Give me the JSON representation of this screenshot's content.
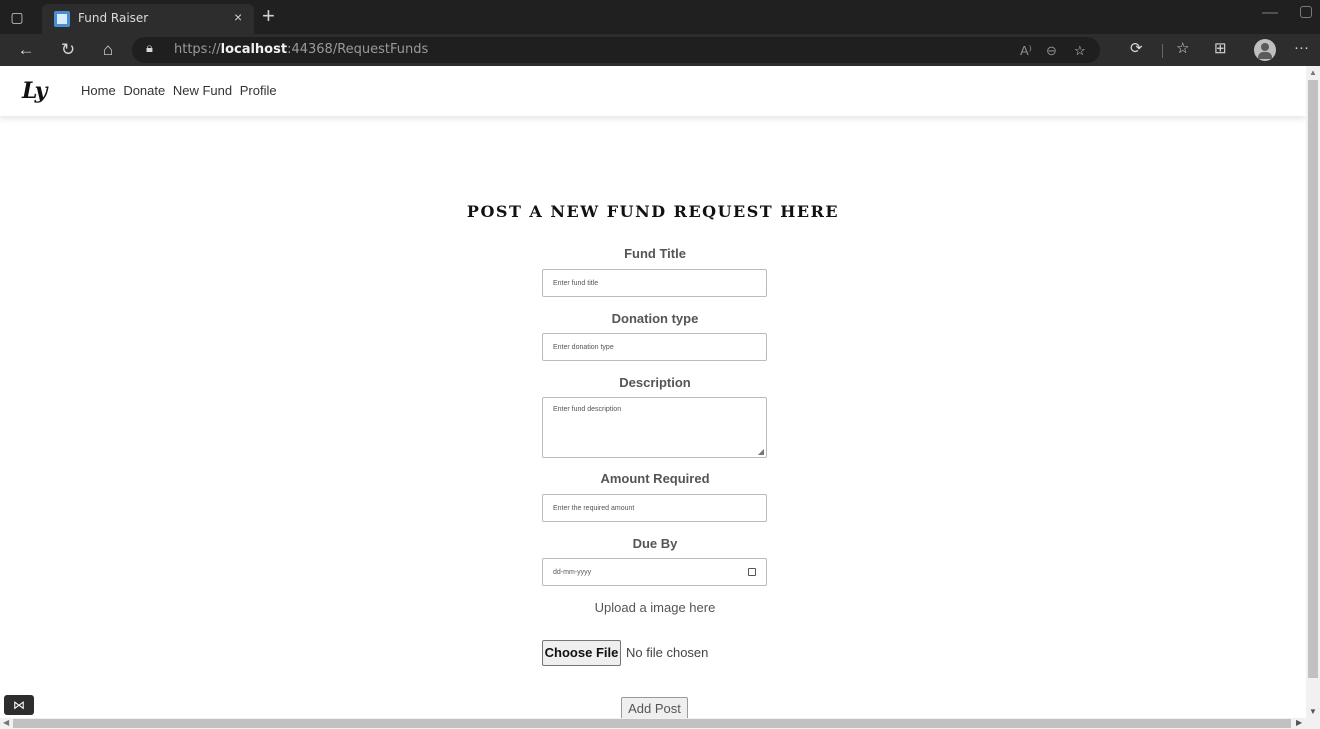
{
  "browser": {
    "tab_title": "Fund Raiser",
    "tab_close": "×",
    "new_tab": "+",
    "url_prefix": "https://",
    "url_host": "localhost",
    "url_path": ":44368/RequestFunds",
    "icons": [
      "sidebar-icon",
      "back-icon",
      "refresh-icon",
      "home-icon",
      "lock-icon",
      "read-aloud-icon",
      "zoom-icon",
      "add-favorite-icon",
      "extensions-icon",
      "favorites-icon",
      "collections-icon",
      "profile-icon",
      "more-icon"
    ]
  },
  "site": {
    "logo": "Ly",
    "nav": [
      "Home",
      "Donate",
      "New Fund",
      "Profile"
    ]
  },
  "form": {
    "title": "POST A NEW FUND REQUEST HERE",
    "fund_title_label": "Fund Title",
    "fund_title_placeholder": "Enter fund title",
    "donation_type_label": "Donation type",
    "donation_type_placeholder": "Enter donation type",
    "description_label": "Description",
    "description_placeholder": "Enter fund description",
    "amount_label": "Amount Required",
    "amount_placeholder": "Enter the required amount",
    "due_label": "Due By",
    "due_placeholder": "dd-mm-yyyy",
    "upload_label": "Upload a image here",
    "choose_file": "Choose File",
    "no_file": "No file chosen",
    "submit": "Add Post"
  }
}
